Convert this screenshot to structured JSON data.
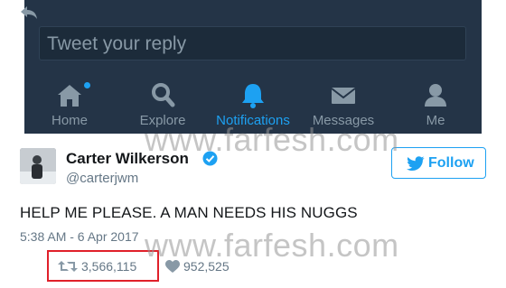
{
  "composer": {
    "placeholder": "Tweet your reply"
  },
  "nav": {
    "items": [
      {
        "label": "Home",
        "icon": "home-icon",
        "active": false
      },
      {
        "label": "Explore",
        "icon": "search-icon",
        "active": false
      },
      {
        "label": "Notifications",
        "icon": "bell-icon",
        "active": true
      },
      {
        "label": "Messages",
        "icon": "envelope-icon",
        "active": false
      },
      {
        "label": "Me",
        "icon": "person-icon",
        "active": false
      }
    ]
  },
  "tweet": {
    "author_name": "Carter Wilkerson",
    "handle": "@carterjwm",
    "follow_label": "Follow",
    "text": "HELP ME PLEASE. A MAN NEEDS HIS NUGGS",
    "timestamp": "5:38 AM - 6 Apr 2017",
    "retweets": "3,566,115",
    "likes": "952,525"
  },
  "watermark": {
    "text": "www.farfesh.com"
  },
  "colors": {
    "accent": "#1da1f2",
    "dark_bg": "#243447",
    "highlight": "#e0202a"
  }
}
